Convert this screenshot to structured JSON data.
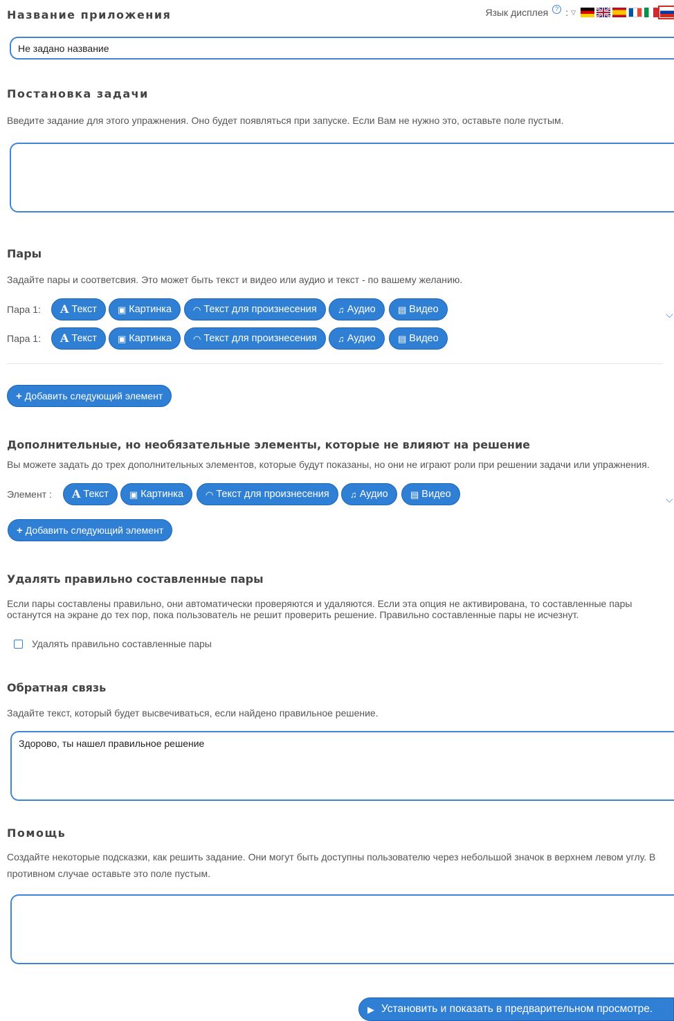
{
  "app_name": {
    "heading": "Название приложения",
    "value": "Не задано название"
  },
  "display_language": {
    "label": "Язык дисплея",
    "help_icon": "?",
    "colon": ":",
    "flags": [
      "de",
      "gb",
      "es",
      "fr",
      "it",
      "ru"
    ]
  },
  "task": {
    "heading": "Постановка задачи",
    "description": "Введите задание для этого упражнения. Оно будет появляться при запуске. Если Вам не нужно это, оставьте поле пустым.",
    "value": ""
  },
  "pairs": {
    "heading": "Пары",
    "description": "Задайте пары и соответсвия. Это может быть текст и видео или аудио и текст - по вашему желанию.",
    "rows": [
      {
        "label": "Пара 1:"
      },
      {
        "label": "Пара 1:"
      }
    ],
    "buttons": {
      "text": "Текст",
      "image": "Картинка",
      "speech": "Текст для произнесения",
      "audio": "Аудио",
      "video": "Видео"
    },
    "add_button": "Добавить следующий элемент"
  },
  "extra": {
    "heading": "Дополнительные, но необязательные элементы, которые не влияют на решение",
    "description": "Вы можете задать до трех дополнительных элементов, которые будут показаны, но они не играют роли при решении задачи или упражнения.",
    "element_label": "Элемент :",
    "add_button": "Добавить следующий элемент"
  },
  "remove_pairs": {
    "heading": "Удалять правильно составленные пары",
    "description_line1": "Если пары составлены правильно, они автоматически проверяются и удаляются. Если эта опция не активирована, то составленные пары",
    "description_line2": "останутся на экране до тех пор, пока пользователь не решит проверить решение. Правильно составленные пары не исчезнут.",
    "checkbox_label": "Удалять правильно составленные пары",
    "checked": false
  },
  "feedback": {
    "heading": "Обратная связь",
    "description": "Задайте текст, который будет высвечиваться, если найдено правильное решение.",
    "value": "Здорово, ты нашел правильное решение"
  },
  "help": {
    "heading": "Помощь",
    "description_line1": "Создайте некоторые подсказки, как решить задание. Они могут быть доступны пользователю через небольшой значок в верхнем левом углу. В",
    "description_line2": "противном случае оставьте это поле пустым.",
    "value": ""
  },
  "submit_button": "Установить и показать в предварительном просмотре.",
  "colors": {
    "accent": "#2f7fd4",
    "field_border": "#3f84d7"
  }
}
